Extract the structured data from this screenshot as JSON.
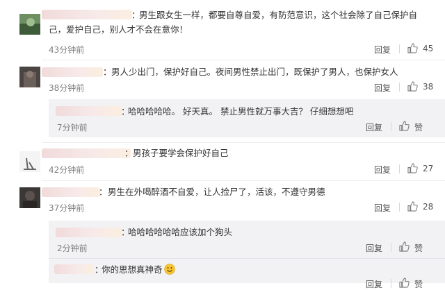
{
  "comments": [
    {
      "colon": "：",
      "text_line1": "男生跟女生一样，都要自尊自爱，有防范意识，这个社会除了自己保护自",
      "text_line2": "己，爱护自己，别人才不会在意你！",
      "time": "43分钟前",
      "reply": "回复",
      "likes": "45"
    },
    {
      "colon": "：",
      "text": "男人少出门，保护好自己。夜间男性禁止出门，既保护了男人，也保护女人",
      "time": "38分钟前",
      "reply": "回复",
      "likes": "38"
    },
    {
      "colon": "：",
      "text": "男孩子要学会保护好自己",
      "time": "42分钟前",
      "reply": "回复",
      "likes": "27"
    },
    {
      "colon": "：",
      "text": "男生在外喝醉酒不自爱，让人捡尸了，活该，不遵守男德",
      "time": "37分钟前",
      "reply": "回复",
      "likes": "28"
    }
  ],
  "replies": [
    {
      "colon": "：",
      "text": "哈哈哈哈哈。 好天真。 禁止男性就万事大吉？  仔细想想吧",
      "time": "7分钟前",
      "reply": "回复",
      "likes": "赞"
    },
    {
      "colon": "：",
      "text": "哈哈哈哈哈哈应该加个狗头",
      "time": "2分钟前",
      "reply": "回复",
      "likes": "赞"
    },
    {
      "colon": "：",
      "text": "你的思想真神奇",
      "reply": "回复",
      "likes": "赞"
    }
  ],
  "colors": {
    "background": "#ffffff",
    "reply_block": "#f2f2f5",
    "blur_name": "#f1dada",
    "time_text": "#808080"
  },
  "icons": [
    "thumbs-up-icon",
    "smile-emoji-icon"
  ]
}
